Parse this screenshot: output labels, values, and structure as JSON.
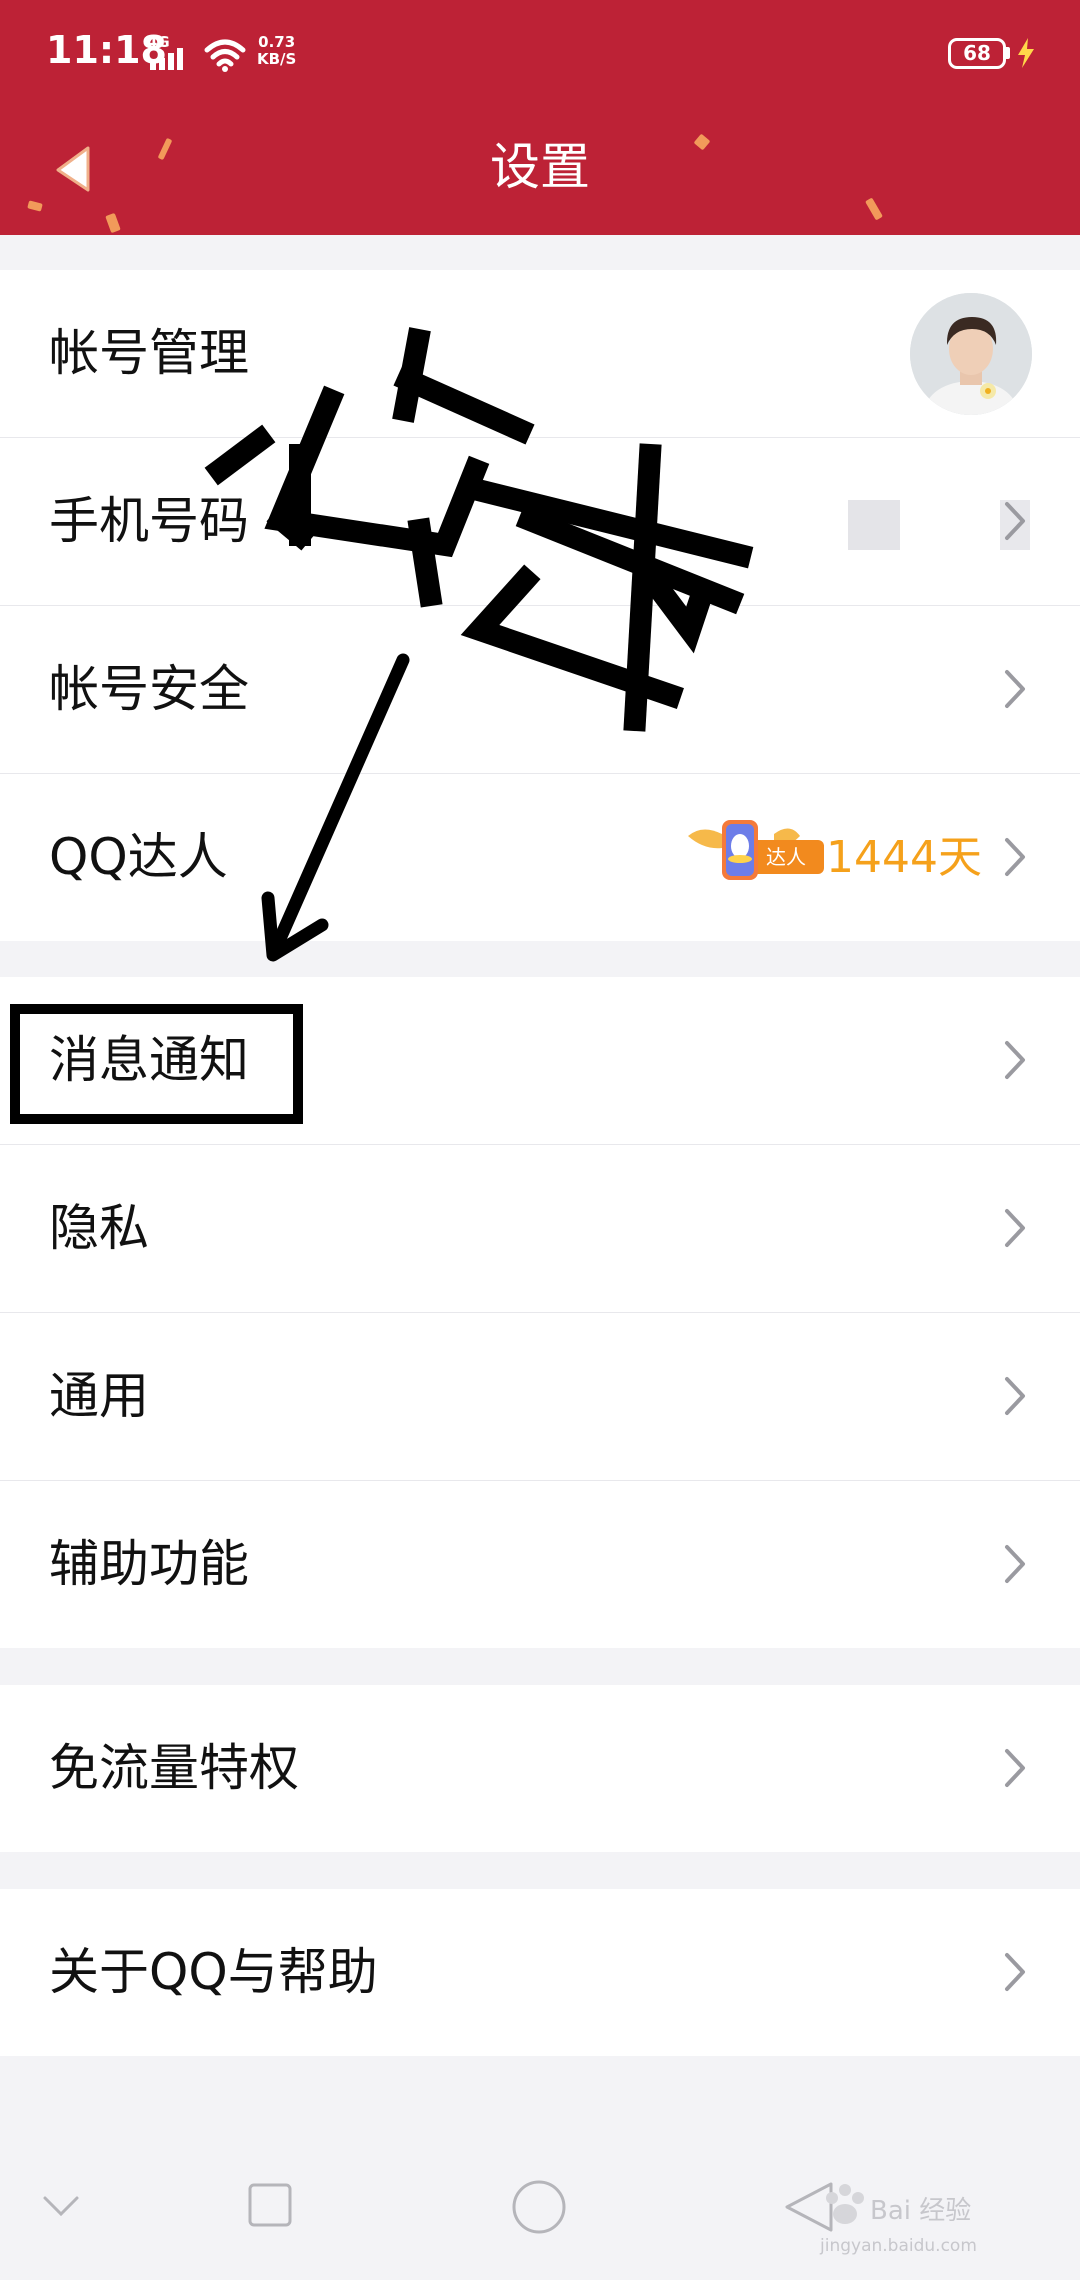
{
  "status_bar": {
    "time": "11:18",
    "network": "4G",
    "speed_value": "0.73",
    "speed_unit": "KB/S",
    "battery": "68"
  },
  "header": {
    "title": "设置",
    "color": "#bd2236"
  },
  "groups": [
    {
      "items": [
        {
          "label": "帐号管理",
          "accessory": "avatar"
        },
        {
          "label": "手机号码",
          "accessory": "masked-phone"
        },
        {
          "label": "帐号安全",
          "accessory": "chevron"
        },
        {
          "label": "QQ达人",
          "badge_text": "达人",
          "value": "1444天",
          "accessory": "chevron"
        }
      ]
    },
    {
      "items": [
        {
          "label": "消息通知",
          "accessory": "chevron"
        },
        {
          "label": "隐私",
          "accessory": "chevron"
        },
        {
          "label": "通用",
          "accessory": "chevron"
        },
        {
          "label": "辅助功能",
          "accessory": "chevron"
        }
      ]
    },
    {
      "items": [
        {
          "label": "免流量特权",
          "accessory": "chevron"
        }
      ]
    },
    {
      "items": [
        {
          "label": "关于QQ与帮助",
          "accessory": "chevron"
        }
      ]
    }
  ],
  "annotation": {
    "handwritten_text": "点击",
    "arrow_color": "#000000"
  },
  "watermark": {
    "text": "Bai 经验",
    "url": "jingyan.baidu.com"
  },
  "colors": {
    "accent_orange": "#f5a11b",
    "background": "#f3f3f6"
  }
}
